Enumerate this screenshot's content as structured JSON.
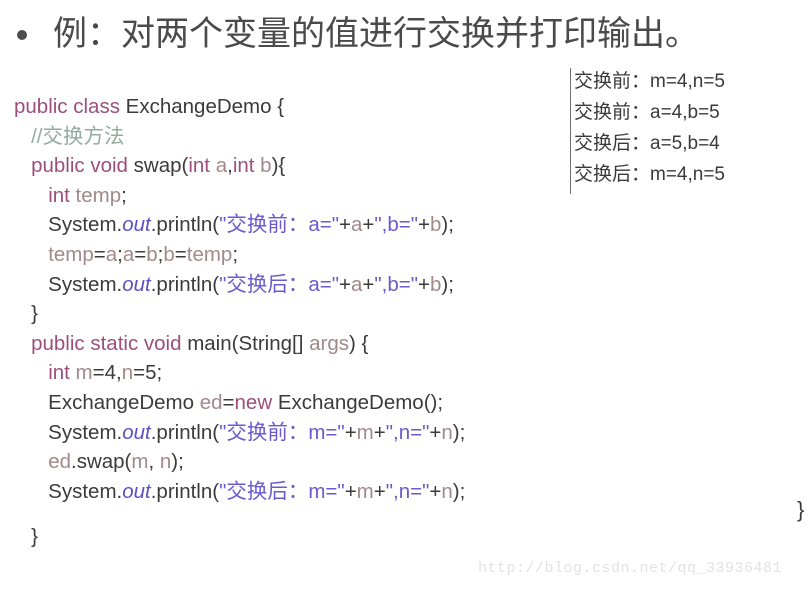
{
  "slide": {
    "title": "例：对两个变量的值进行交换并打印输出。",
    "bullet_glyph": "•"
  },
  "code": {
    "language": "java",
    "lines": [
      [
        {
          "t": "kw",
          "s": "public class "
        },
        {
          "t": "pln",
          "s": "ExchangeDemo {"
        }
      ],
      [
        {
          "t": "pln",
          "s": "   "
        },
        {
          "t": "cm",
          "s": "//交换方法"
        }
      ],
      [
        {
          "t": "pln",
          "s": "   "
        },
        {
          "t": "kw",
          "s": "public void "
        },
        {
          "t": "pln",
          "s": "swap("
        },
        {
          "t": "kw",
          "s": "int "
        },
        {
          "t": "var",
          "s": "a"
        },
        {
          "t": "pln",
          "s": ","
        },
        {
          "t": "kw",
          "s": "int "
        },
        {
          "t": "var",
          "s": "b"
        },
        {
          "t": "pln",
          "s": "){"
        }
      ],
      [
        {
          "t": "pln",
          "s": "      "
        },
        {
          "t": "kw",
          "s": "int "
        },
        {
          "t": "var",
          "s": "temp"
        },
        {
          "t": "pln",
          "s": ";"
        }
      ],
      [
        {
          "t": "pln",
          "s": "      System."
        },
        {
          "t": "fld",
          "s": "out"
        },
        {
          "t": "pln",
          "s": ".println("
        },
        {
          "t": "str",
          "s": "\"交换前：a=\""
        },
        {
          "t": "pln",
          "s": "+"
        },
        {
          "t": "var",
          "s": "a"
        },
        {
          "t": "pln",
          "s": "+"
        },
        {
          "t": "str",
          "s": "\",b=\""
        },
        {
          "t": "pln",
          "s": "+"
        },
        {
          "t": "var",
          "s": "b"
        },
        {
          "t": "pln",
          "s": ");"
        }
      ],
      [
        {
          "t": "pln",
          "s": "      "
        },
        {
          "t": "var",
          "s": "temp"
        },
        {
          "t": "pln",
          "s": "="
        },
        {
          "t": "var",
          "s": "a"
        },
        {
          "t": "pln",
          "s": ";"
        },
        {
          "t": "var",
          "s": "a"
        },
        {
          "t": "pln",
          "s": "="
        },
        {
          "t": "var",
          "s": "b"
        },
        {
          "t": "pln",
          "s": ";"
        },
        {
          "t": "var",
          "s": "b"
        },
        {
          "t": "pln",
          "s": "="
        },
        {
          "t": "var",
          "s": "temp"
        },
        {
          "t": "pln",
          "s": ";"
        }
      ],
      [
        {
          "t": "pln",
          "s": "      System."
        },
        {
          "t": "fld",
          "s": "out"
        },
        {
          "t": "pln",
          "s": ".println("
        },
        {
          "t": "str",
          "s": "\"交换后：a=\""
        },
        {
          "t": "pln",
          "s": "+"
        },
        {
          "t": "var",
          "s": "a"
        },
        {
          "t": "pln",
          "s": "+"
        },
        {
          "t": "str",
          "s": "\",b=\""
        },
        {
          "t": "pln",
          "s": "+"
        },
        {
          "t": "var",
          "s": "b"
        },
        {
          "t": "pln",
          "s": ");"
        }
      ],
      [
        {
          "t": "pln",
          "s": "   }"
        }
      ],
      [
        {
          "t": "pln",
          "s": "   "
        },
        {
          "t": "kw",
          "s": "public static void "
        },
        {
          "t": "pln",
          "s": "main(String[] "
        },
        {
          "t": "var",
          "s": "args"
        },
        {
          "t": "pln",
          "s": ") {"
        }
      ],
      [
        {
          "t": "pln",
          "s": "      "
        },
        {
          "t": "kw",
          "s": "int "
        },
        {
          "t": "var",
          "s": "m"
        },
        {
          "t": "pln",
          "s": "=4,"
        },
        {
          "t": "var",
          "s": "n"
        },
        {
          "t": "pln",
          "s": "=5;"
        }
      ],
      [
        {
          "t": "pln",
          "s": "      ExchangeDemo "
        },
        {
          "t": "var",
          "s": "ed"
        },
        {
          "t": "pln",
          "s": "="
        },
        {
          "t": "kw",
          "s": "new "
        },
        {
          "t": "pln",
          "s": "ExchangeDemo();"
        }
      ],
      [
        {
          "t": "pln",
          "s": "      System."
        },
        {
          "t": "fld",
          "s": "out"
        },
        {
          "t": "pln",
          "s": ".println("
        },
        {
          "t": "str",
          "s": "\"交换前：m=\""
        },
        {
          "t": "pln",
          "s": "+"
        },
        {
          "t": "var",
          "s": "m"
        },
        {
          "t": "pln",
          "s": "+"
        },
        {
          "t": "str",
          "s": "\",n=\""
        },
        {
          "t": "pln",
          "s": "+"
        },
        {
          "t": "var",
          "s": "n"
        },
        {
          "t": "pln",
          "s": ");"
        }
      ],
      [
        {
          "t": "pln",
          "s": "      "
        },
        {
          "t": "var",
          "s": "ed"
        },
        {
          "t": "pln",
          "s": ".swap("
        },
        {
          "t": "var",
          "s": "m"
        },
        {
          "t": "pln",
          "s": ", "
        },
        {
          "t": "var",
          "s": "n"
        },
        {
          "t": "pln",
          "s": ");"
        }
      ],
      [
        {
          "t": "pln",
          "s": "      System."
        },
        {
          "t": "fld",
          "s": "out"
        },
        {
          "t": "pln",
          "s": ".println("
        },
        {
          "t": "str",
          "s": "\"交换后：m=\""
        },
        {
          "t": "pln",
          "s": "+"
        },
        {
          "t": "var",
          "s": "m"
        },
        {
          "t": "pln",
          "s": "+"
        },
        {
          "t": "str",
          "s": "\",n=\""
        },
        {
          "t": "pln",
          "s": "+"
        },
        {
          "t": "var",
          "s": "n"
        },
        {
          "t": "pln",
          "s": ");"
        }
      ],
      [
        {
          "t": "pln",
          "s": ""
        }
      ]
    ],
    "tail_line": [
      {
        "t": "pln",
        "s": "   }"
      }
    ],
    "stray_brace": "}"
  },
  "console_output": {
    "lines": [
      "交换前：m=4,n=5",
      "交换前：a=4,b=5",
      "交换后：a=5,b=4",
      "交换后：m=4,n=5"
    ]
  },
  "watermark": {
    "text": "http://blog.csdn.net/qq_33936481"
  },
  "colors": {
    "keyword": "#9c4f7d",
    "comment": "#92ac9d",
    "string": "#6a5acd",
    "variable": "#a1898a",
    "field": "#5b51c8",
    "plain": "#3b3b3b",
    "title": "#4a4a4a",
    "watermark": "#e2e2e2",
    "background": "#ffffff"
  }
}
